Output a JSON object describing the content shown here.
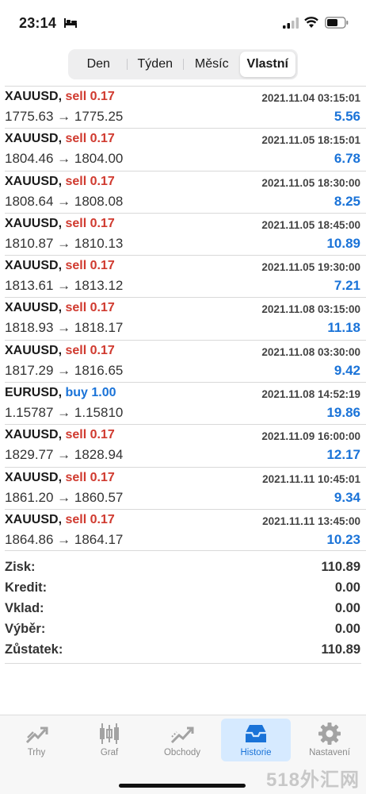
{
  "status_bar": {
    "time": "23:14"
  },
  "segment": {
    "items": [
      "Den",
      "Týden",
      "Měsíc",
      "Vlastní"
    ],
    "selected": "Vlastní"
  },
  "history": [
    {
      "symbol": "XAUUSD,",
      "type": "sell 0.17",
      "time": "2021.11.04 03:15:01",
      "prices": "1775.63 → 1775.25",
      "profit": "5.56"
    },
    {
      "symbol": "XAUUSD,",
      "type": "sell 0.17",
      "time": "2021.11.05 18:15:01",
      "prices": "1804.46 → 1804.00",
      "profit": "6.78"
    },
    {
      "symbol": "XAUUSD,",
      "type": "sell 0.17",
      "time": "2021.11.05 18:30:00",
      "prices": "1808.64 → 1808.08",
      "profit": "8.25"
    },
    {
      "symbol": "XAUUSD,",
      "type": "sell 0.17",
      "time": "2021.11.05 18:45:00",
      "prices": "1810.87 → 1810.13",
      "profit": "10.89"
    },
    {
      "symbol": "XAUUSD,",
      "type": "sell 0.17",
      "time": "2021.11.05 19:30:00",
      "prices": "1813.61 → 1813.12",
      "profit": "7.21"
    },
    {
      "symbol": "XAUUSD,",
      "type": "sell 0.17",
      "time": "2021.11.08 03:15:00",
      "prices": "1818.93 → 1818.17",
      "profit": "11.18"
    },
    {
      "symbol": "XAUUSD,",
      "type": "sell 0.17",
      "time": "2021.11.08 03:30:00",
      "prices": "1817.29 → 1816.65",
      "profit": "9.42"
    },
    {
      "symbol": "EURUSD,",
      "type": "buy 1.00",
      "time": "2021.11.08 14:52:19",
      "prices": "1.15787 → 1.15810",
      "profit": "19.86"
    },
    {
      "symbol": "XAUUSD,",
      "type": "sell 0.17",
      "time": "2021.11.09 16:00:00",
      "prices": "1829.77 → 1828.94",
      "profit": "12.17"
    },
    {
      "symbol": "XAUUSD,",
      "type": "sell 0.17",
      "time": "2021.11.11 10:45:01",
      "prices": "1861.20 → 1860.57",
      "profit": "9.34"
    },
    {
      "symbol": "XAUUSD,",
      "type": "sell 0.17",
      "time": "2021.11.11 13:45:00",
      "prices": "1864.86 → 1864.17",
      "profit": "10.23"
    }
  ],
  "summary": [
    {
      "label": "Zisk:",
      "value": "110.89"
    },
    {
      "label": "Kredit:",
      "value": "0.00"
    },
    {
      "label": "Vklad:",
      "value": "0.00"
    },
    {
      "label": "Výběr:",
      "value": "0.00"
    },
    {
      "label": "Zůstatek:",
      "value": "110.89"
    }
  ],
  "tabs": [
    {
      "label": "Trhy",
      "icon": "trend-arrows-icon"
    },
    {
      "label": "Graf",
      "icon": "candlestick-icon"
    },
    {
      "label": "Obchody",
      "icon": "trade-chart-icon"
    },
    {
      "label": "Historie",
      "icon": "inbox-tray-icon",
      "active": true
    },
    {
      "label": "Nastavení",
      "icon": "gear-icon"
    }
  ],
  "colors": {
    "sell": "#d03a2f",
    "buy": "#1a73d8",
    "profit": "#1a73d8",
    "active_tab_bg": "#d6eaff"
  },
  "watermark": "518外汇网"
}
